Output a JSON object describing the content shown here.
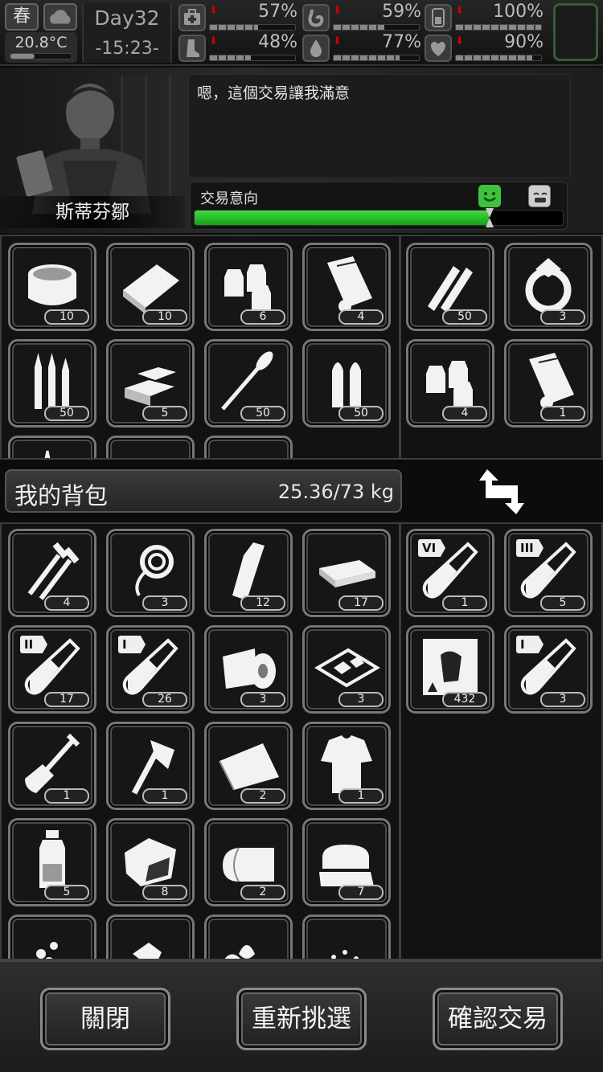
{
  "status": {
    "season": "春",
    "temperature": "20.8°C",
    "day": "Day32",
    "time": "-15:23-",
    "stats": [
      {
        "icon": "medkit-icon",
        "value": "57%",
        "fill": 0.57
      },
      {
        "icon": "stomach-icon",
        "value": "59%",
        "fill": 0.59
      },
      {
        "icon": "battery-icon",
        "value": "100%",
        "fill": 1.0
      },
      {
        "icon": "foot-icon",
        "value": "48%",
        "fill": 0.48
      },
      {
        "icon": "water-drop-icon",
        "value": "77%",
        "fill": 0.77
      },
      {
        "icon": "heart-icon",
        "value": "90%",
        "fill": 0.9
      }
    ]
  },
  "npc": {
    "name": "斯蒂芬鄒",
    "dialogue": "嗯，這個交易讓我滿意",
    "intent_label": "交易意向",
    "intent_level": 0.8
  },
  "merchant_items": [
    {
      "icon": "canned-food-icon",
      "qty": "10"
    },
    {
      "icon": "bread-icon",
      "qty": "10"
    },
    {
      "icon": "seed-bags-icon",
      "qty": "6"
    },
    {
      "icon": "scroll-map-icon",
      "qty": "4"
    },
    {
      "icon": "rifle-ammo-icon",
      "qty": "50"
    },
    {
      "icon": "gold-bars-icon",
      "qty": "5"
    },
    {
      "icon": "rpg-rocket-icon",
      "qty": "50"
    },
    {
      "icon": "pistol-ammo-icon",
      "qty": "50"
    },
    {
      "icon": "arrows-icon",
      "qty": ""
    },
    {
      "icon": "unknown-item-icon",
      "qty": ""
    },
    {
      "icon": "unknown-item-icon",
      "qty": ""
    }
  ],
  "merchant_offer": [
    {
      "icon": "rifle-bullets-icon",
      "qty": "50"
    },
    {
      "icon": "diamond-ring-icon",
      "qty": "3"
    },
    {
      "icon": "seed-bags-icon",
      "qty": "4"
    },
    {
      "icon": "scroll-map-icon",
      "qty": "1"
    }
  ],
  "backpack": {
    "title": "我的背包",
    "weight": "25.36/73 kg",
    "items": [
      {
        "icon": "nails-icon",
        "qty": "4"
      },
      {
        "icon": "rope-icon",
        "qty": "3"
      },
      {
        "icon": "bottle-icon",
        "qty": "12"
      },
      {
        "icon": "cash-stack-icon",
        "qty": "17"
      },
      {
        "icon": "test-tube-icon",
        "tier": "II",
        "qty": "17"
      },
      {
        "icon": "test-tube-icon",
        "tier": "I",
        "qty": "26"
      },
      {
        "icon": "bandage-roll-icon",
        "qty": "3"
      },
      {
        "icon": "food-tray-icon",
        "qty": "3"
      },
      {
        "icon": "shovel-icon",
        "qty": "1"
      },
      {
        "icon": "axe-icon",
        "qty": "1"
      },
      {
        "icon": "cloth-icon",
        "qty": "2"
      },
      {
        "icon": "ragged-shirt-icon",
        "qty": "1"
      },
      {
        "icon": "medicine-bottle-icon",
        "qty": "5"
      },
      {
        "icon": "ore-chunk-icon",
        "qty": "8"
      },
      {
        "icon": "towel-icon",
        "qty": "2"
      },
      {
        "icon": "folded-fabric-icon",
        "qty": "7"
      },
      {
        "icon": "pills-icon",
        "qty": ""
      },
      {
        "icon": "crystals-icon",
        "qty": ""
      },
      {
        "icon": "leaves-icon",
        "qty": ""
      },
      {
        "icon": "seeds-icon",
        "qty": ""
      }
    ]
  },
  "my_offer": [
    {
      "icon": "test-tube-icon",
      "tier": "VI",
      "qty": "1"
    },
    {
      "icon": "test-tube-icon",
      "tier": "III",
      "qty": "5"
    },
    {
      "icon": "zombie-poster-icon",
      "qty": "432"
    },
    {
      "icon": "test-tube-icon",
      "tier": "I",
      "qty": "3"
    }
  ],
  "buttons": {
    "close": "關閉",
    "reselect": "重新挑選",
    "confirm": "確認交易"
  }
}
